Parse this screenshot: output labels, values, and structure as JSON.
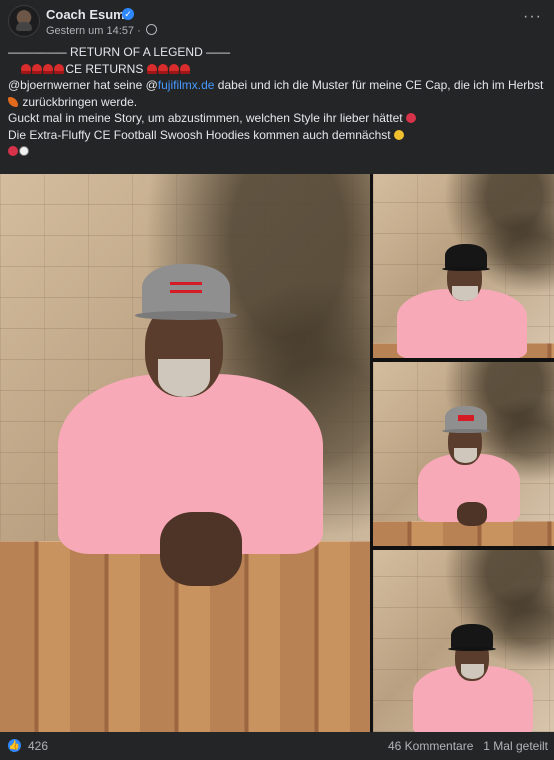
{
  "post": {
    "author": "Coach Esume",
    "timestamp": "Gestern um 14:57",
    "more_label": "···",
    "verified_icon": "✓",
    "lines": {
      "title": "—––––––– RETURN OF A LEGEND ——",
      "subtitle": "CE RETURNS",
      "line1_prefix": "@bjoernwerner hat seine @",
      "mention": "fujifilmx.de",
      "line1_suffix": " dabei und ich die Muster für meine CE Cap, die ich im Herbst",
      "line2": "zurückbringen werde.",
      "line3": "Guckt mal in meine Story, um abzustimmen, welchen Style ihr lieber hättet",
      "line4": "Die Extra-Fluffy CE Football Swoosh Hoodies kommen auch demnächst"
    },
    "icons": [
      "siren-emoji",
      "leaf-emoji",
      "kiss-emoji",
      "eye-emoji",
      "smile-emoji"
    ],
    "colors": {
      "mention": "#4599ff",
      "background": "#242526",
      "shirt": "#f7a9b8",
      "cap_red_logo": "#d51b24"
    }
  },
  "stats": {
    "likes": "426",
    "comments": "46 Kommentare",
    "shares": "1 Mal geteilt"
  }
}
